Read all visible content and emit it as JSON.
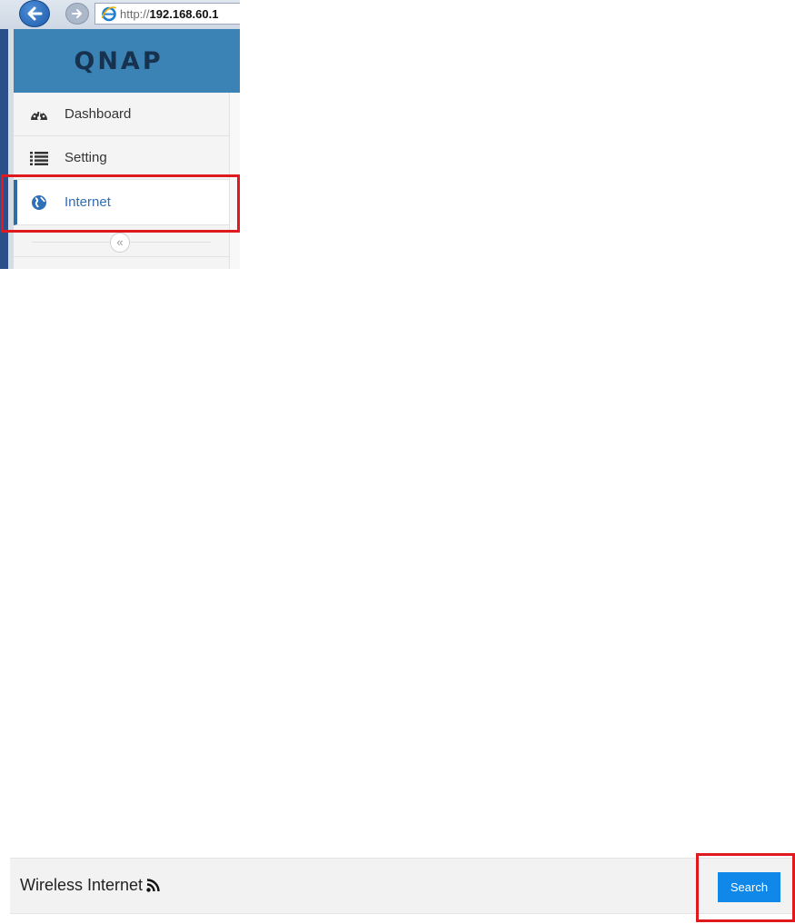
{
  "browser": {
    "url_protocol": "http://",
    "url_host": "192.168.60.1",
    "back_icon": "back-arrow-icon",
    "forward_icon": "forward-arrow-icon",
    "page_icon": "ie-logo-icon"
  },
  "app": {
    "logo_text": "QNAP",
    "brand_color": "#3b82b5"
  },
  "sidebar": {
    "items": [
      {
        "label": "Dashboard",
        "icon": "dashboard-gauge-icon",
        "active": false
      },
      {
        "label": "Setting",
        "icon": "list-icon",
        "active": false
      },
      {
        "label": "Internet",
        "icon": "globe-icon",
        "active": true
      }
    ],
    "collapse_glyph": "«"
  },
  "wireless": {
    "title": "Wireless Internet",
    "icon": "rss-wifi-icon",
    "search_label": "Search",
    "search_color": "#1088ea"
  },
  "highlights": {
    "color": "#e0191e"
  }
}
